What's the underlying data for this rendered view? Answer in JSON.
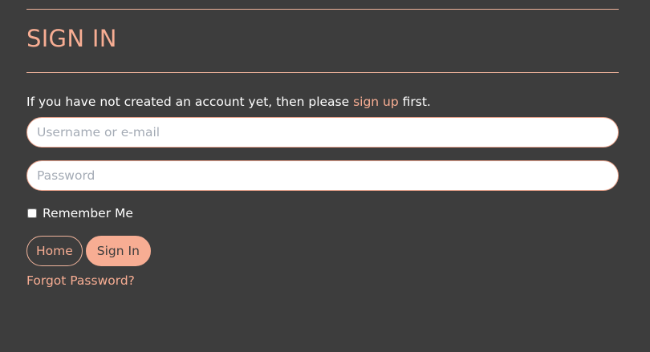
{
  "form": {
    "title": "SIGN IN",
    "intro_before": "If you have not created an account yet, then please ",
    "signup_link": "sign up",
    "intro_after": " first.",
    "username_placeholder": "Username or e-mail",
    "username_value": "",
    "password_placeholder": "Password",
    "password_value": "",
    "remember_label": "Remember Me",
    "remember_checked": false,
    "home_button": "Home",
    "signin_button": "Sign In",
    "forgot_link": "Forgot Password?"
  },
  "colors": {
    "background": "#3d3d3d",
    "accent": "#f7ad93",
    "text": "#ffffff"
  }
}
